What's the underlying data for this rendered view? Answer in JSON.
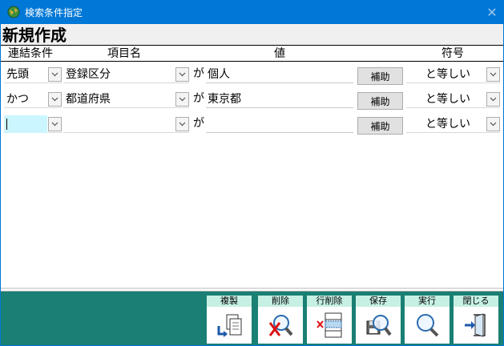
{
  "window": {
    "title": "検索条件指定",
    "close_glyph": "✕"
  },
  "form_title": "新規作成",
  "columns": {
    "connector": "連結条件",
    "item": "項目名",
    "value": "値",
    "operator": "符号"
  },
  "ga": "が",
  "aux_label": "補助",
  "rows": [
    {
      "connector": "先頭",
      "item": "登録区分",
      "value": "個人",
      "operator": "と等しい"
    },
    {
      "connector": "かつ",
      "item": "都道府県",
      "value": "東京都",
      "operator": "と等しい"
    },
    {
      "connector": "",
      "item": "",
      "value": "",
      "operator": "と等しい"
    }
  ],
  "toolbar": {
    "copy": "複製",
    "delete": "削除",
    "delete_row": "行削除",
    "save": "保存",
    "execute": "実行",
    "close": "閉じる"
  },
  "colors": {
    "titlebar": "#0078d7",
    "footer": "#1a7f74",
    "button_label": "#c6f0e4",
    "focus_cell": "#ccf6ff"
  }
}
